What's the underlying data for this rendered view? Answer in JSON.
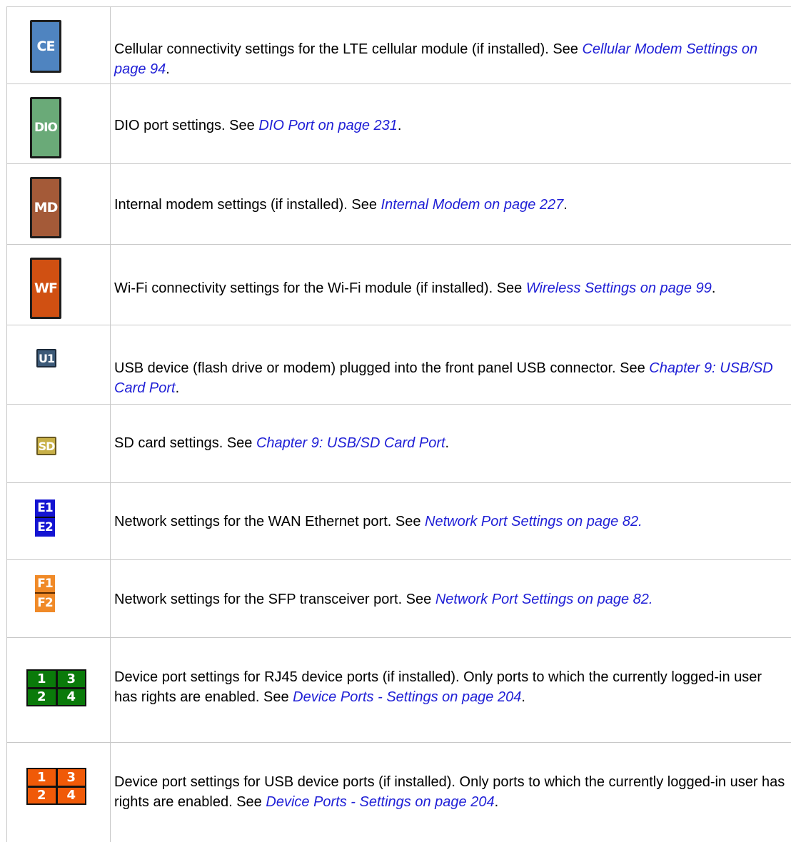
{
  "colors": {
    "ce": "#4f84c0",
    "dio": "#6aaa78",
    "md": "#a45a38",
    "wf": "#d05012",
    "u1": "#3c5a78",
    "sd": "#c8b048",
    "e": "#1414d2",
    "f": "#f08a28",
    "rj45_grid": "#0a7a0a",
    "usb_grid": "#f05a08",
    "link": "#1f1fd6"
  },
  "rows": [
    {
      "icon_label": "CE",
      "icon_name": "cellular-icon",
      "text": "Cellular connectivity settings for the LTE cellular module (if installed). See ",
      "link": "Cellular Modem Settings on page 94",
      "suffix": "."
    },
    {
      "icon_label": "DIO",
      "icon_name": "dio-icon",
      "text": "DIO port settings. See ",
      "link": "DIO Port on page 231",
      "suffix": "."
    },
    {
      "icon_label": "MD",
      "icon_name": "modem-icon",
      "text": "Internal modem settings (if installed). See ",
      "link": "Internal Modem on page 227",
      "suffix": "."
    },
    {
      "icon_label": "WF",
      "icon_name": "wifi-icon",
      "text": "Wi-Fi connectivity settings for the Wi-Fi module (if installed). See ",
      "link": "Wireless Settings on page 99",
      "suffix": "."
    },
    {
      "icon_label": "U1",
      "icon_name": "usb-device-icon",
      "text": "USB device (flash drive or modem) plugged into the front panel USB connector. See ",
      "link": "Chapter 9: USB/SD Card Port",
      "suffix": "."
    },
    {
      "icon_label": "SD",
      "icon_name": "sd-card-icon",
      "text": "SD card settings. See ",
      "link": "Chapter 9: USB/SD Card Port",
      "suffix": "."
    },
    {
      "icon_labels": [
        "E1",
        "E2"
      ],
      "icon_name": "ethernet-ports-icon",
      "text": "Network settings for the WAN Ethernet port. See ",
      "link": "Network Port Settings on page 82.",
      "suffix": ""
    },
    {
      "icon_labels": [
        "F1",
        "F2"
      ],
      "icon_name": "sfp-ports-icon",
      "text": "Network settings for the SFP transceiver port. See ",
      "link": "Network Port Settings on page 82.",
      "suffix": ""
    },
    {
      "icon_labels": [
        "1",
        "3",
        "2",
        "4"
      ],
      "icon_name": "rj45-device-ports-icon",
      "text": "Device port settings for RJ45 device ports (if installed).  Only ports to which the currently logged-in user has rights are enabled. See ",
      "link": "Device Ports - Settings on page 204",
      "suffix": "."
    },
    {
      "icon_labels": [
        "1",
        "3",
        "2",
        "4"
      ],
      "icon_name": "usb-device-ports-icon",
      "text": "Device port settings for USB device ports (if installed). Only ports to which the currently logged-in user has rights are enabled. See ",
      "link": "Device Ports - Settings on page 204",
      "suffix": "."
    }
  ]
}
